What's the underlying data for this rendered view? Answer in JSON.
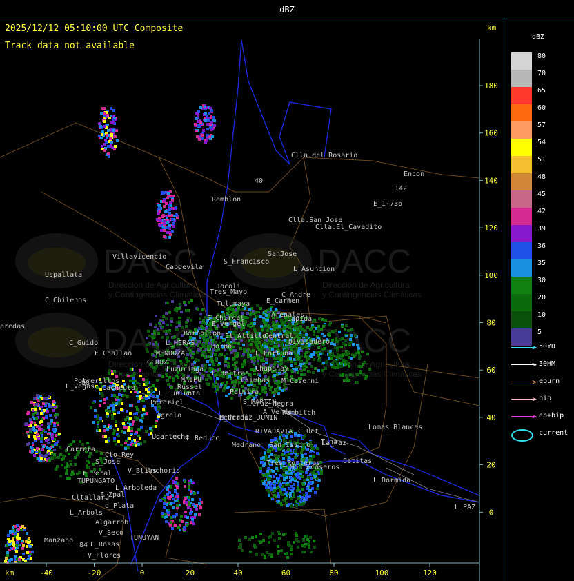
{
  "window_title": "dBZ",
  "header": {
    "timestamp": "2025/12/12 05:10:00 UTC Composite",
    "notice": "Track data not available",
    "km_top": "km",
    "km_bottom": "km"
  },
  "axes": {
    "x_ticks": [
      "-40",
      "-20",
      "0",
      "20",
      "40",
      "60",
      "80",
      "100",
      "120"
    ],
    "y_ticks": [
      "180",
      "160",
      "140",
      "120",
      "100",
      "80",
      "60",
      "40",
      "20",
      "0"
    ]
  },
  "watermark": {
    "logo_text": "DACC",
    "line1": "Dirección de Agricultura",
    "line2": "y Contingencias Climáticas"
  },
  "places": [
    "Clla.del_Rosario",
    "Encon",
    "142",
    "E_1-736",
    "Ramblon",
    "Clla.San_Jose",
    "Clla.El_Cavadito",
    "Villavicencio",
    "S_Francisco",
    "SanJose",
    "Uspallata",
    "Capdevila",
    "L_Asuncion",
    "C_Andre",
    "C_Chilenos",
    "Tres_Mayo",
    "Tulumaya",
    "E_Carmen",
    "E_Chircal",
    "Arenales",
    "Lapida",
    "aredas",
    "Borbollon",
    "E_Vergel",
    "Jocoli",
    "El_Altillo",
    "Central",
    "Divisadero",
    "C_Guido",
    "E_Challao",
    "L_HERAS",
    "L_Horno",
    "MENDOZA",
    "GCRUZ",
    "Chimbas",
    "Chapanay",
    "L_Fortuna",
    "Luzuriaga",
    "L_Beltran",
    "M_Caserni",
    "Potrerillos",
    "Cacheuta",
    "MAIPU",
    "Russel",
    "Cruz_Negra",
    "L_Vegas",
    "Perdriel",
    "L_Lunlunta",
    "S_MARTIN",
    "Palmira",
    "A_Verde",
    "Rambitch",
    "Agrelo",
    "E_Perdiz_JUNIN",
    "Lomas_Blancas",
    "Ugarteche",
    "RIVADAVIA",
    "San_Isidro",
    "Medrano",
    "L_Reducc",
    "C_Oct",
    "La_Paz",
    "L_Carrera",
    "Cto_Rey",
    "S_Jose",
    "Tres_Porteras",
    "Montecaseros",
    "Catitas",
    "E_Peral",
    "TUPUNGATO",
    "V_Btias",
    "Anchoris",
    "L_Dormida",
    "L_Arboleda",
    "Cltallarú",
    "E_Zpal",
    "d_Plata",
    "L_Arbols",
    "L_PAZ",
    "Algarrob",
    "V_Seco",
    "TUNUYAN",
    "Manzano",
    "L_Rosas",
    "V_Flores",
    "Ugarteche",
    "Medrano",
    "Tuna",
    "40",
    "88",
    "84"
  ],
  "legend": {
    "title": "dBZ",
    "levels": [
      {
        "label": "80",
        "color": "#d4d4d4"
      },
      {
        "label": "70",
        "color": "#b8b8b8"
      },
      {
        "label": "65",
        "color": "#ff3a2a"
      },
      {
        "label": "60",
        "color": "#ff6a10"
      },
      {
        "label": "57",
        "color": "#ff9a60"
      },
      {
        "label": "54",
        "color": "#ffff00"
      },
      {
        "label": "51",
        "color": "#f4c030"
      },
      {
        "label": "48",
        "color": "#d08838"
      },
      {
        "label": "45",
        "color": "#c86888"
      },
      {
        "label": "42",
        "color": "#d42a92"
      },
      {
        "label": "39",
        "color": "#8818cc"
      },
      {
        "label": "36",
        "color": "#2050e8"
      },
      {
        "label": "35",
        "color": "#1a90e0"
      },
      {
        "label": "30",
        "color": "#108010"
      },
      {
        "label": "20",
        "color": "#0b6a0b"
      },
      {
        "label": "10",
        "color": "#0a500a"
      },
      {
        "label": "5",
        "color": "#483c96"
      }
    ],
    "tracks": [
      {
        "label": "50YD",
        "color": "#40e0ff"
      },
      {
        "label": "30HM",
        "color": "#ffffff"
      },
      {
        "label": "eburn",
        "color": "#e0a860"
      },
      {
        "label": "bip",
        "color": "#ffb8c8"
      },
      {
        "label": "eb+bip",
        "color": "#e040e0"
      },
      {
        "label": "current",
        "color": "#30e0f0"
      }
    ]
  }
}
